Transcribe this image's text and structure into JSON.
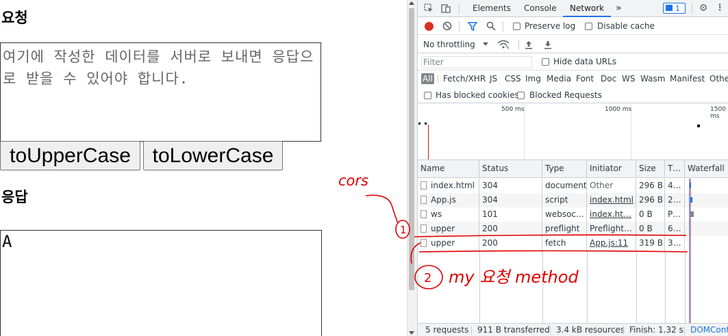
{
  "page": {
    "request_heading": "요청",
    "request_text": "여기에 작성한 데이터를 서버로 보내면 응답으로 받을 수 있어야 합니다.",
    "upper_button": "toUpperCase",
    "lower_button": "toLowerCase",
    "response_heading": "응답",
    "response_text": "A"
  },
  "devtools": {
    "tabs": [
      "Elements",
      "Console",
      "Network"
    ],
    "active_tab": "Network",
    "more_tabs": "»",
    "issues_badge": "1",
    "toolbar": {
      "preserve_log": "Preserve log",
      "disable_cache": "Disable cache",
      "throttling": "No throttling"
    },
    "filter": {
      "placeholder": "Filter",
      "hide_data_urls": "Hide data URLs",
      "types": [
        "All",
        "Fetch/XHR",
        "JS",
        "CSS",
        "Img",
        "Media",
        "Font",
        "Doc",
        "WS",
        "Wasm",
        "Manifest",
        "Other"
      ],
      "selected_type": "All",
      "blocked_cookies": "Has blocked cookies",
      "blocked_requests": "Blocked Requests"
    },
    "overview_ticks": [
      "500 ms",
      "1000 ms",
      "1500 ms"
    ],
    "columns": [
      "Name",
      "Status",
      "Type",
      "Initiator",
      "Size",
      "T…",
      "Waterfall"
    ],
    "rows": [
      {
        "name": "index.html",
        "status": "304",
        "type": "document",
        "initiator": "Other",
        "size": "296 B",
        "time": "4…"
      },
      {
        "name": "App.js",
        "status": "304",
        "type": "script",
        "initiator": "index.html",
        "size": "296 B",
        "time": "2…"
      },
      {
        "name": "ws",
        "status": "101",
        "type": "websoc…",
        "initiator": "index.ht…",
        "size": "0 B",
        "time": "P…"
      },
      {
        "name": "upper",
        "status": "200",
        "type": "preflight",
        "initiator": "Preflight…",
        "size": "0 B",
        "time": "6…"
      },
      {
        "name": "upper",
        "status": "200",
        "type": "fetch",
        "initiator": "App.js:11",
        "size": "319 B",
        "time": "3…"
      }
    ],
    "status_bar": {
      "requests": "5 requests",
      "transferred": "911 B transferred",
      "resources": "3.4 kB resources",
      "finish": "Finish: 1.32 s",
      "domcontent": "DOMConte"
    },
    "colors": {
      "accent": "#1a73e8",
      "record": "#d93025",
      "annotation": "#e00000"
    }
  },
  "annotations": {
    "cors": "cors",
    "num1": "1",
    "num2": "2",
    "note": "my 요청 method"
  }
}
